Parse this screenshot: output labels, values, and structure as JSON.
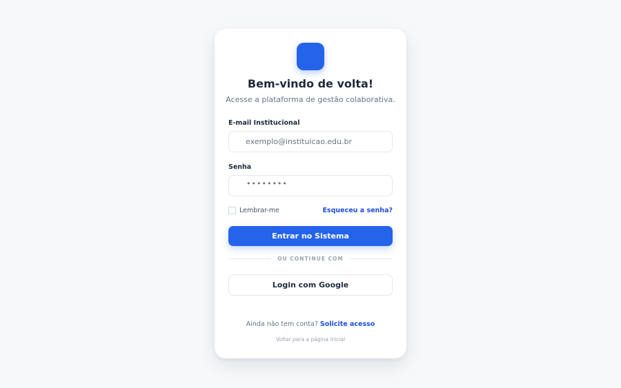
{
  "login": {
    "title": "Bem-vindo de volta!",
    "subtitle": "Acesse a plataforma de gestão colaborativa.",
    "email": {
      "label": "E-mail Institucional",
      "placeholder": "exemplo@instituicao.edu.br"
    },
    "password": {
      "label": "Senha",
      "masked_value": "••••••••"
    },
    "remember_label": "Lembrar-me",
    "forgot_label": "Esqueceu a senha?",
    "submit_label": "Entrar no Sistema",
    "divider_text": "OU CONTINUE COM",
    "google_label": "Login com Google",
    "signup_prompt": "Ainda não tem conta?",
    "signup_link": "Solicite acesso",
    "back_link": "Voltar para a página inicial"
  },
  "colors": {
    "accent": "#2563eb",
    "link": "#1d4ed8",
    "background": "#f7f8fa"
  },
  "icons": {
    "logo": "app-logo-icon"
  }
}
